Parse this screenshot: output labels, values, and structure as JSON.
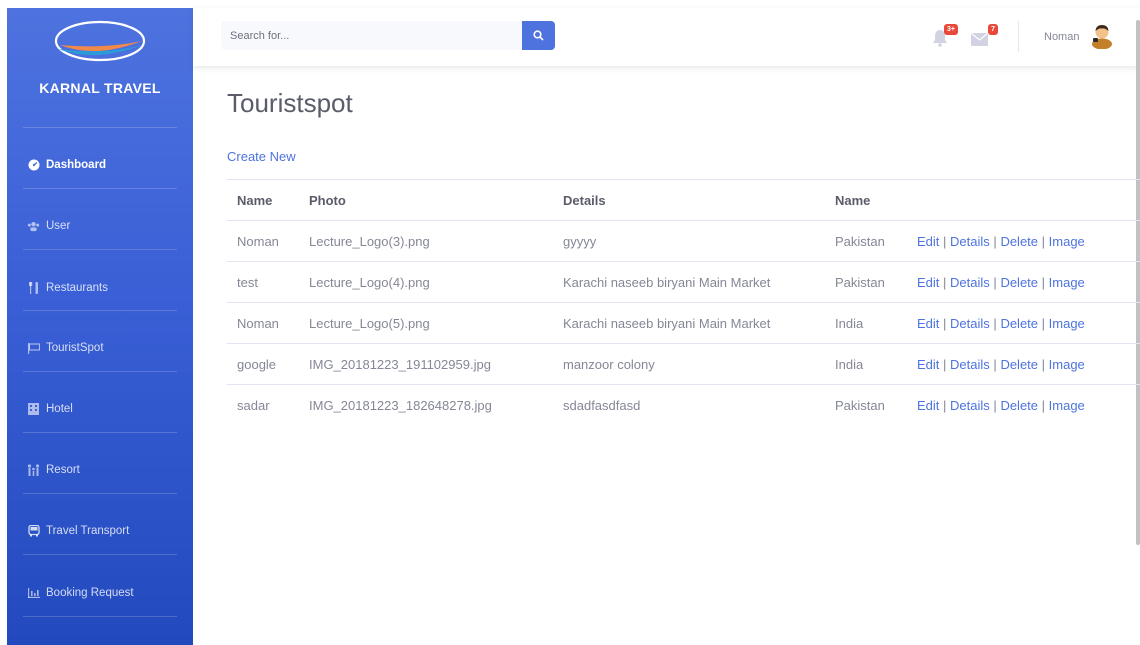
{
  "brand": {
    "name": "KARNAL TRAVEL"
  },
  "sidebar": {
    "items": [
      {
        "label": "Dashboard",
        "icon": "dashboard-icon",
        "active": true
      },
      {
        "label": "User",
        "icon": "users-icon",
        "active": false
      },
      {
        "label": "Restaurants",
        "icon": "utensils-icon",
        "active": false
      },
      {
        "label": "TouristSpot",
        "icon": "flag-icon",
        "active": false
      },
      {
        "label": "Hotel",
        "icon": "building-icon",
        "active": false
      },
      {
        "label": "Resort",
        "icon": "family-icon",
        "active": false
      },
      {
        "label": "Travel Transport",
        "icon": "bus-icon",
        "active": false
      },
      {
        "label": "Booking Request",
        "icon": "chart-icon",
        "active": false
      }
    ]
  },
  "topbar": {
    "search_placeholder": "Search for...",
    "alerts_badge": "3+",
    "messages_badge": "7",
    "user_name": "Noman"
  },
  "main": {
    "title": "Touristspot",
    "create_link": "Create New",
    "table": {
      "headers": [
        "Name",
        "Photo",
        "Details",
        "Name",
        ""
      ],
      "rows": [
        {
          "name": "Noman",
          "photo": "Lecture_Logo(3).png",
          "details": "gyyyy",
          "country": "Pakistan"
        },
        {
          "name": "test",
          "photo": "Lecture_Logo(4).png",
          "details": "Karachi naseeb biryani Main Market",
          "country": "Pakistan"
        },
        {
          "name": "Noman",
          "photo": "Lecture_Logo(5).png",
          "details": "Karachi naseeb biryani Main Market",
          "country": "India"
        },
        {
          "name": "google",
          "photo": "IMG_20181223_191102959.jpg",
          "details": "manzoor colony",
          "country": "India"
        },
        {
          "name": "sadar",
          "photo": "IMG_20181223_182648278.jpg",
          "details": "sdadfasdfasd",
          "country": "Pakistan"
        }
      ],
      "actions": {
        "edit": "Edit",
        "details": "Details",
        "delete": "Delete",
        "image": "Image",
        "separator": "|"
      }
    }
  },
  "colors": {
    "primary": "#4e73df",
    "sidebar_dark": "#224abe",
    "badge": "#e74a3b",
    "text": "#858796",
    "heading": "#5a5c69"
  }
}
